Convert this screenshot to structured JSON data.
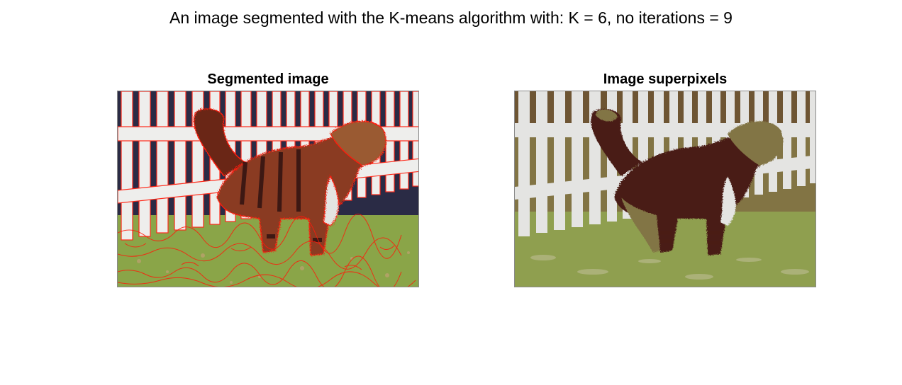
{
  "figure": {
    "title": "An image segmented with the K-means algorithm with: K = 6, no iterations = 9"
  },
  "panels": [
    {
      "title": "Segmented image",
      "image_desc": "dog-fence-photo-with-red-segment-boundaries"
    },
    {
      "title": "Image superpixels",
      "image_desc": "dog-fence-photo-quantized-6-colors"
    }
  ],
  "colors": {
    "boundary": "#ff0000",
    "cluster_palette": [
      "#e4e4e2",
      "#4a1c14",
      "#827444",
      "#8b9a4a",
      "#b7b98a",
      "#1e1f3a"
    ]
  }
}
